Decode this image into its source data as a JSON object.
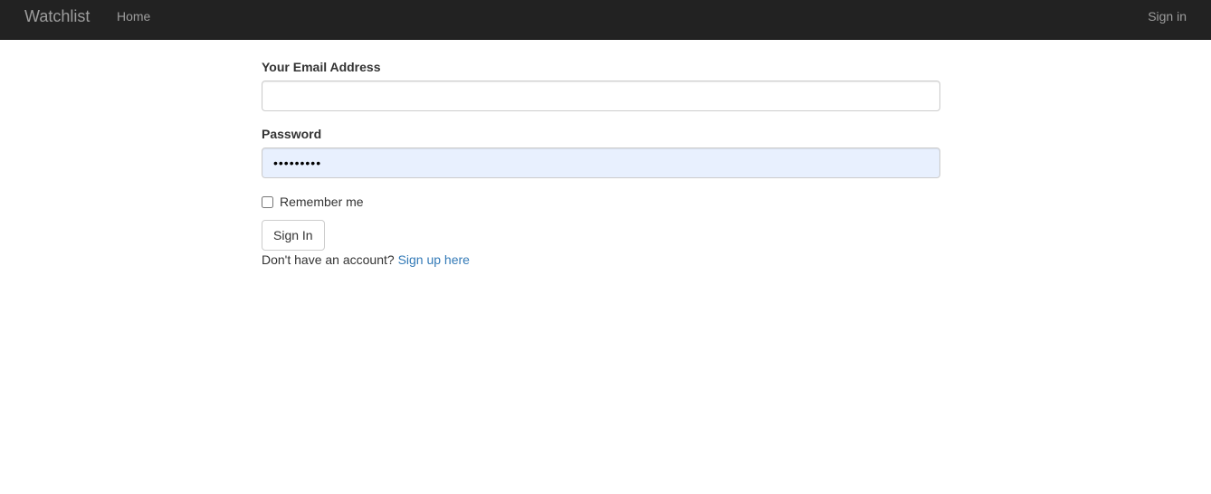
{
  "navbar": {
    "brand": "Watchlist",
    "home_label": "Home",
    "signin_label": "Sign in"
  },
  "form": {
    "email_label": "Your Email Address",
    "email_value": "",
    "password_label": "Password",
    "password_value": "•••••••••",
    "remember_label": "Remember me",
    "remember_checked": false,
    "submit_label": "Sign In",
    "signup_prompt": "Don't have an account?",
    "signup_link": "Sign up here"
  },
  "colors": {
    "navbar_bg": "#222222",
    "nav_text": "#9d9d9d",
    "link": "#337ab7",
    "autofill_bg": "#e8f0fe"
  }
}
